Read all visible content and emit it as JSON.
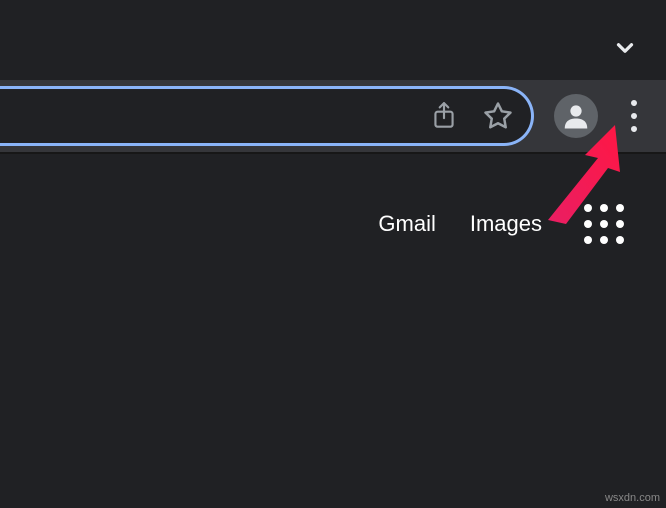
{
  "links": {
    "gmail": "Gmail",
    "images": "Images"
  },
  "watermark": "wsxdn.com",
  "colors": {
    "focus_ring": "#8ab4f8",
    "annotation_arrow": "#e91e63"
  }
}
